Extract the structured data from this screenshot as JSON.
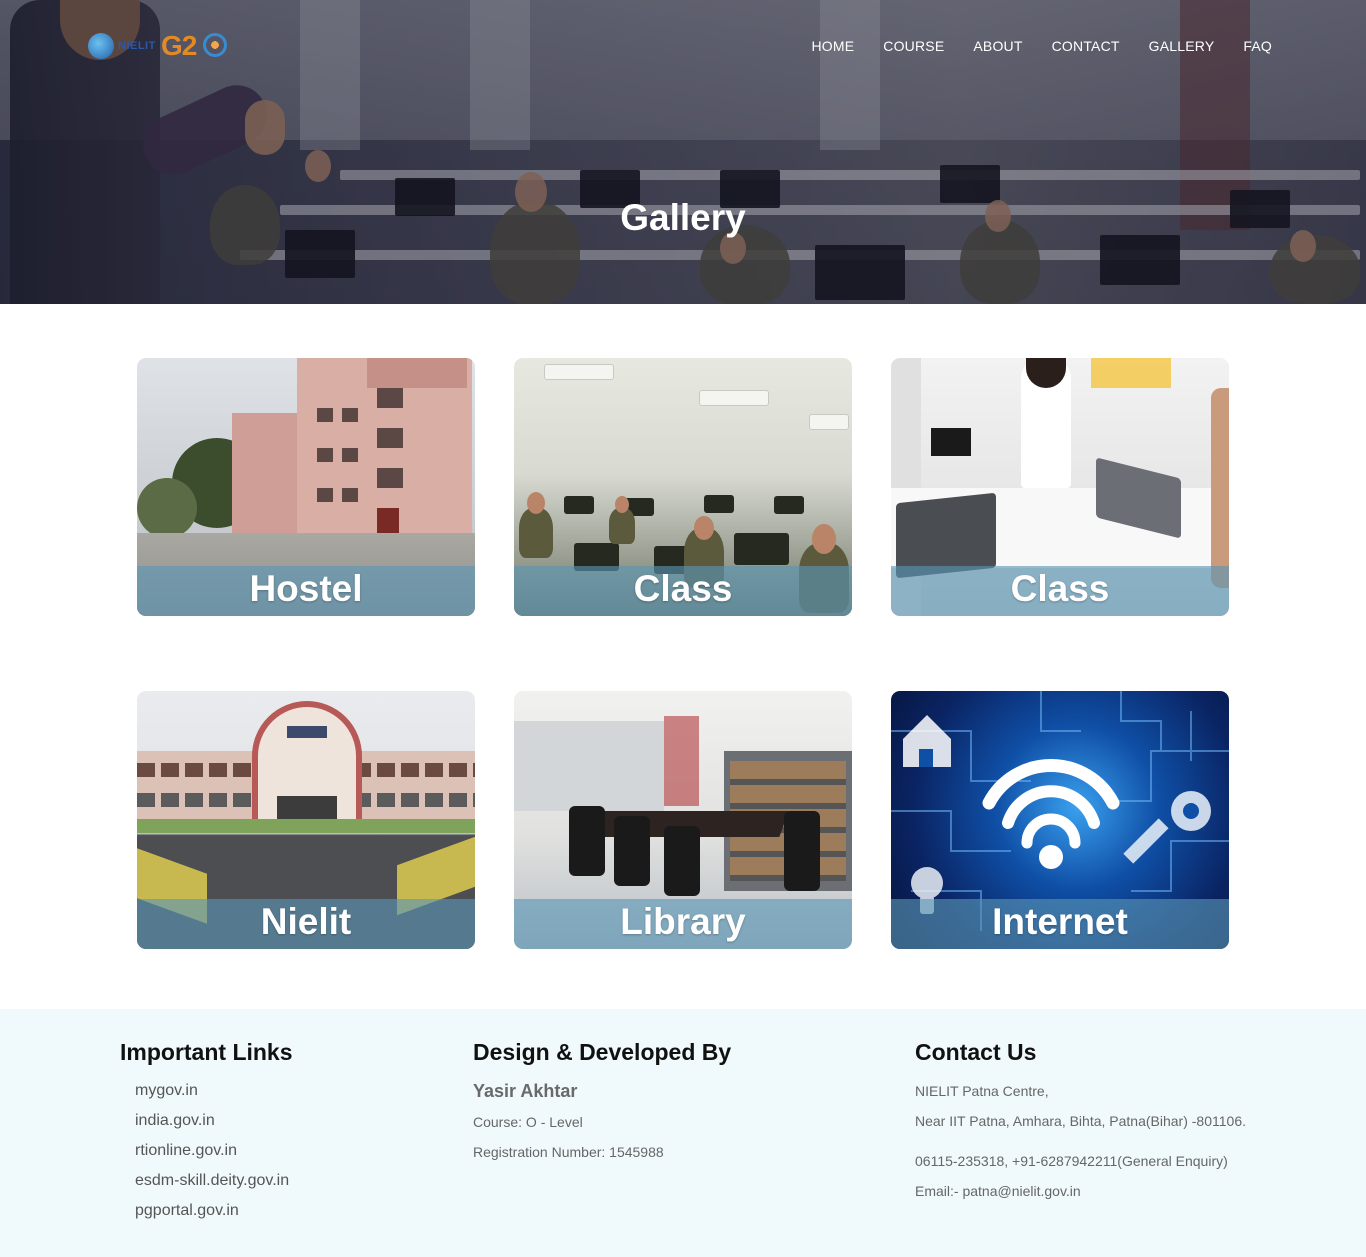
{
  "nav": {
    "items": [
      "HOME",
      "COURSE",
      "ABOUT",
      "CONTACT",
      "GALLERY",
      "FAQ"
    ]
  },
  "logo": {
    "org": "NIELIT",
    "event": "G2"
  },
  "hero": {
    "title": "Gallery"
  },
  "gallery": {
    "items": [
      {
        "label": "Hostel"
      },
      {
        "label": "Class"
      },
      {
        "label": "Class"
      },
      {
        "label": "Nielit"
      },
      {
        "label": "Library"
      },
      {
        "label": "Internet"
      }
    ]
  },
  "footer": {
    "links": {
      "title": "Important Links",
      "items": [
        "mygov.in",
        "india.gov.in",
        "rtionline.gov.in",
        "esdm-skill.deity.gov.in",
        "pgportal.gov.in"
      ]
    },
    "developer": {
      "title": "Design & Developed By",
      "name": "Yasir Akhtar",
      "course": "Course: O - Level",
      "registration": "Registration Number: 1545988"
    },
    "contact": {
      "title": "Contact Us",
      "line1": "NIELIT Patna Centre,",
      "line2": "Near IIT Patna, Amhara, Bihta, Patna(Bihar) -801106.",
      "phone": "06115-235318, +91-6287942211(General Enquiry)",
      "email": "Email:- patna@nielit.gov.in"
    }
  },
  "colors": {
    "footer_bg": "#f0fafd",
    "card_band": "#5a96b4",
    "nav_text": "#ffffff"
  }
}
